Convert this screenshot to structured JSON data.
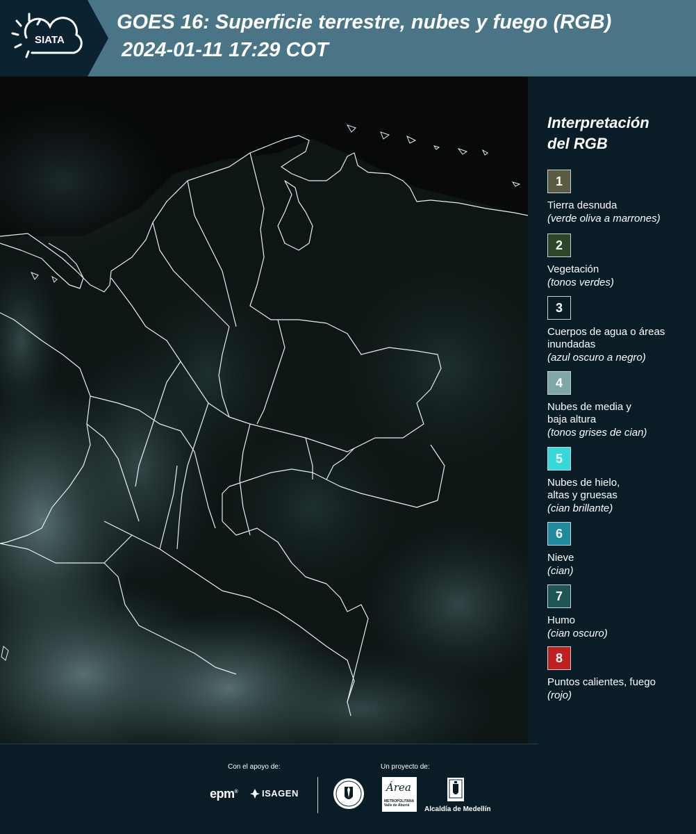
{
  "header": {
    "logo_text": "SIATA",
    "title_line1": "GOES 16: Superficie terrestre, nubes y fuego (RGB)",
    "title_line2": "2024-01-11 17:29 COT",
    "background_color": "#4a7586",
    "logo_box_color": "#0b2230"
  },
  "legend": {
    "title_line1": "Interpretación",
    "title_line2": "del RGB",
    "items": [
      {
        "number": "1",
        "color": "#5b5b42",
        "label": "Tierra desnuda",
        "sub": "(verde oliva a marrones)"
      },
      {
        "number": "2",
        "color": "#2e4628",
        "label": "Vegetación",
        "sub": "(tonos verdes)"
      },
      {
        "number": "3",
        "color": "#0a1d26",
        "label": "Cuerpos de agua o áreas inundadas",
        "sub": "(azul oscuro a negro)"
      },
      {
        "number": "4",
        "color": "#7fa7a8",
        "label": "Nubes de media y baja altura",
        "sub": "(tonos grises de cian)"
      },
      {
        "number": "5",
        "color": "#36d9d9",
        "label": "Nubes de hielo, altas y gruesas",
        "sub": "(cian brillante)"
      },
      {
        "number": "6",
        "color": "#1d8aa0",
        "label": "Nieve",
        "sub": "(cian)"
      },
      {
        "number": "7",
        "color": "#1f5555",
        "label": "Humo",
        "sub": "(cian oscuro)"
      },
      {
        "number": "8",
        "color": "#c01f1f",
        "label": "Puntos calientes, fuego",
        "sub": "(rojo)"
      }
    ]
  },
  "footer": {
    "support_label": "Con el apoyo de:",
    "project_label": "Un proyecto de:",
    "epm": "epm",
    "isagen": "ISAGEN",
    "area_word": "Área",
    "area_sub": "METROPOLITANA Valle de Aburrá",
    "alcaldia": "Alcaldía de Medellín"
  },
  "map": {
    "icon": "satellite-map",
    "land_color": "#0f1a18",
    "cloud_color": "#5f7f82",
    "border_color": "#e8eef0"
  }
}
